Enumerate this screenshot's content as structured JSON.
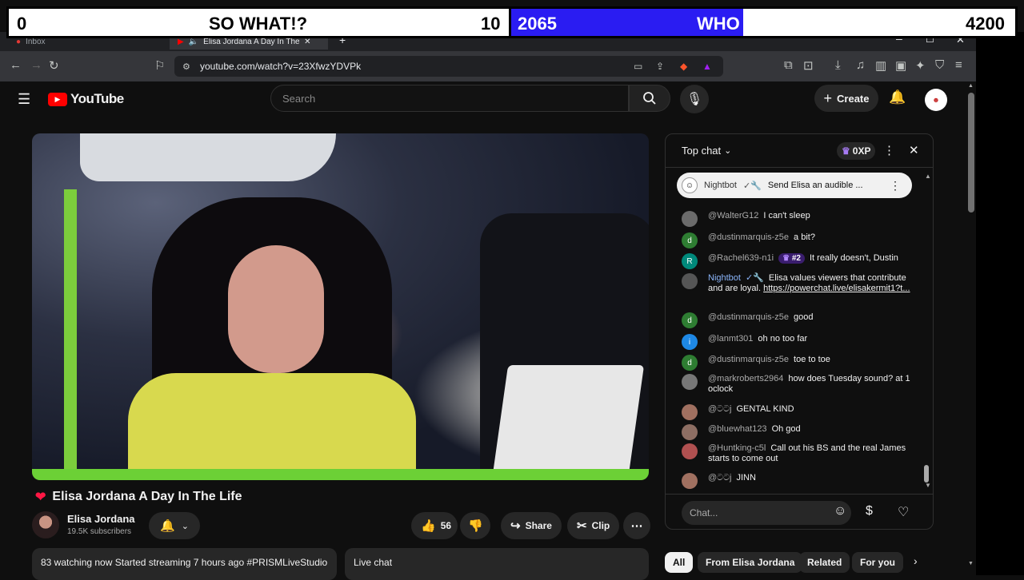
{
  "scoreboard": {
    "left_score": "0",
    "left_label": "SO WHAT!?",
    "left_count": "10",
    "right_score": "2065",
    "right_label": "WHO CARES!?",
    "right_count": "4200"
  },
  "browser": {
    "tabs": [
      {
        "label": "Inbox"
      },
      {
        "label": "Elisa Jordana A Day In The"
      }
    ],
    "url": "youtube.com/watch?v=23XfwzYDVPk"
  },
  "youtube": {
    "logo_text": "YouTube",
    "search_placeholder": "Search",
    "create_label": "Create"
  },
  "video": {
    "title": "Elisa Jordana A Day In The Life",
    "channel": "Elisa Jordana",
    "subscribers": "19.5K subscribers",
    "likes": "56",
    "share_label": "Share",
    "clip_label": "Clip",
    "description": "83 watching now  Started streaming 7 hours ago  #PRISMLiveStudio",
    "live_chat_label": "Live chat"
  },
  "chat": {
    "header": "Top chat",
    "xp": "0XP",
    "pinned": {
      "author": "Nightbot",
      "text": "Send Elisa an audible ..."
    },
    "messages": [
      {
        "author": "@WalterG12",
        "text": "I can't sleep",
        "avatar": "",
        "color": "#6b6b6b"
      },
      {
        "author": "@dustinmarquis-z5e",
        "text": "a bit?",
        "avatar": "d",
        "color": "#2e7d32"
      },
      {
        "author": "@Rachel639-n1i",
        "badge": "#2",
        "text": "It really doesn't, Dustin",
        "avatar": "R",
        "color": "#00897b"
      },
      {
        "author": "Nightbot",
        "text": "Elisa values viewers that contribute and are loyal. ",
        "link": "https://powerchat.live/elisakermit1?t...",
        "avatar": "",
        "color": "#555"
      },
      {
        "author": "@dustinmarquis-z5e",
        "text": "good",
        "avatar": "d",
        "color": "#2e7d32"
      },
      {
        "author": "@lanmt301",
        "text": "oh no too far",
        "avatar": "i",
        "color": "#1e88e5"
      },
      {
        "author": "@dustinmarquis-z5e",
        "text": "toe to toe",
        "avatar": "d",
        "color": "#2e7d32"
      },
      {
        "author": "@markroberts2964",
        "text": "how does Tuesday sound? at 1 oclock",
        "avatar": "",
        "color": "#777"
      },
      {
        "author": "@ටටj",
        "text": "GENTAL KIND",
        "avatar": "",
        "color": "#a07060"
      },
      {
        "author": "@bluewhat123",
        "text": "Oh god",
        "avatar": "",
        "color": "#8d6e63"
      },
      {
        "author": "@Huntking-c5l",
        "text": "Call out his BS and the real James starts to come out",
        "avatar": "",
        "color": "#b05050"
      },
      {
        "author": "@ටටj",
        "text": "JINN",
        "avatar": "",
        "color": "#a07060"
      }
    ],
    "input_placeholder": "Chat..."
  },
  "chips": [
    "All",
    "From Elisa Jordana",
    "Related",
    "For you"
  ],
  "colors": {
    "accent_red": "#ff0000",
    "score_blue": "#2a1cf2"
  }
}
